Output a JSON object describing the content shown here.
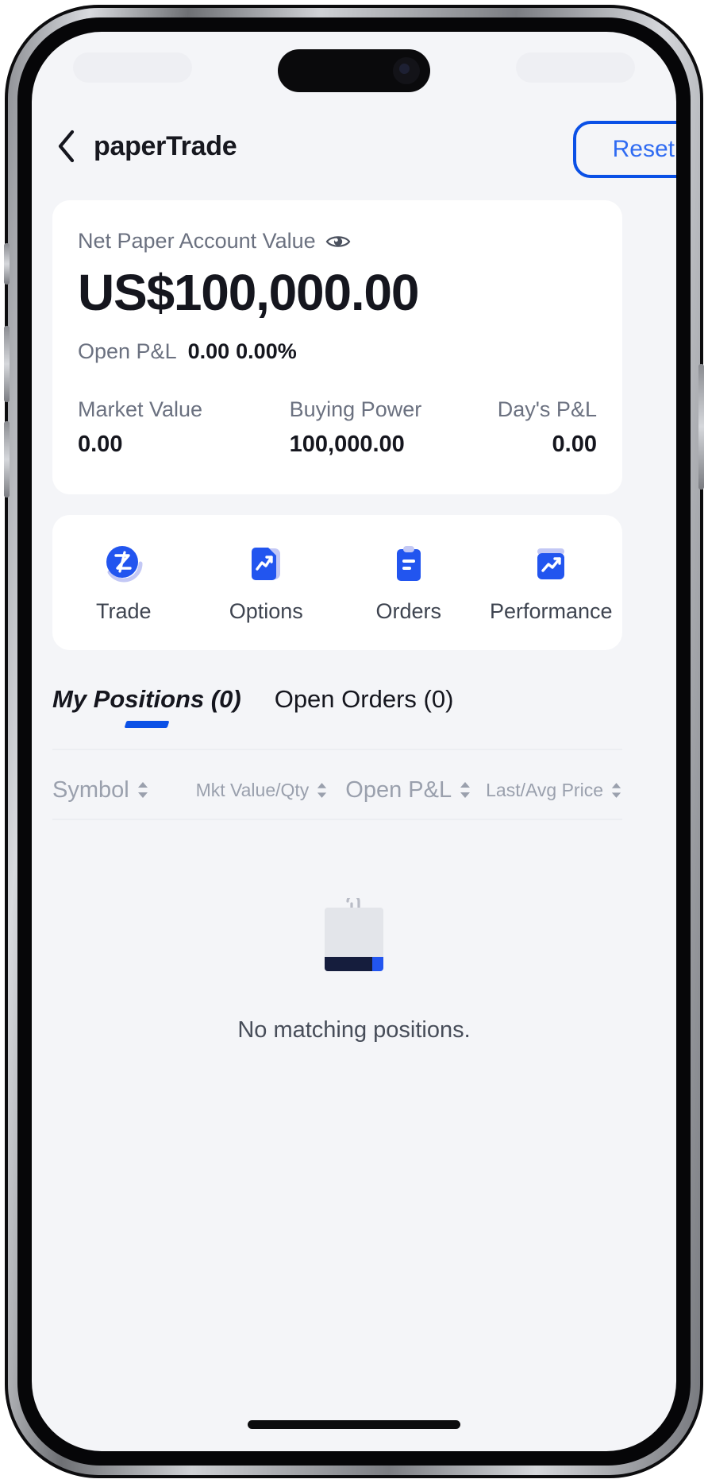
{
  "header": {
    "title": "paperTrade",
    "back_icon": "chevron-left-icon",
    "reset_label": "Reset"
  },
  "account": {
    "label": "Net Paper Account Value",
    "visibility_icon": "eye-icon",
    "value": "US$100,000.00",
    "open_pl_label": "Open P&L",
    "open_pl_value": "0.00",
    "open_pl_percent": "0.00%",
    "stats": [
      {
        "label": "Market Value",
        "value": "0.00"
      },
      {
        "label": "Buying Power",
        "value": "100,000.00"
      },
      {
        "label": "Day's P&L",
        "value": "0.00"
      }
    ]
  },
  "actions": [
    {
      "label": "Trade",
      "icon": "trade-circle-icon"
    },
    {
      "label": "Options",
      "icon": "options-document-icon"
    },
    {
      "label": "Orders",
      "icon": "orders-clipboard-icon"
    },
    {
      "label": "Performance",
      "icon": "performance-chart-icon"
    }
  ],
  "tabs": [
    {
      "label": "My Positions (0)",
      "active": true
    },
    {
      "label": "Open Orders (0)",
      "active": false
    }
  ],
  "columns": [
    {
      "label": "Symbol",
      "sort_icon": "sort-updown-icon"
    },
    {
      "label": "Mkt Value/Qty",
      "sort_icon": "sort-updown-icon"
    },
    {
      "label": "Open P&L",
      "sort_icon": "sort-updown-icon"
    },
    {
      "label": "Last/Avg Price",
      "sort_icon": "sort-updown-icon"
    }
  ],
  "empty_state": {
    "illustration_icon": "empty-document-clip-icon",
    "message": "No matching positions."
  },
  "colors": {
    "accent_blue": "#0a50e6",
    "link_blue": "#2f6bf2",
    "text_dark": "#15161e",
    "text_muted": "#6b7180",
    "text_faint": "#9aa0ad",
    "screen_bg": "#f4f5f8",
    "card_bg": "#ffffff"
  }
}
